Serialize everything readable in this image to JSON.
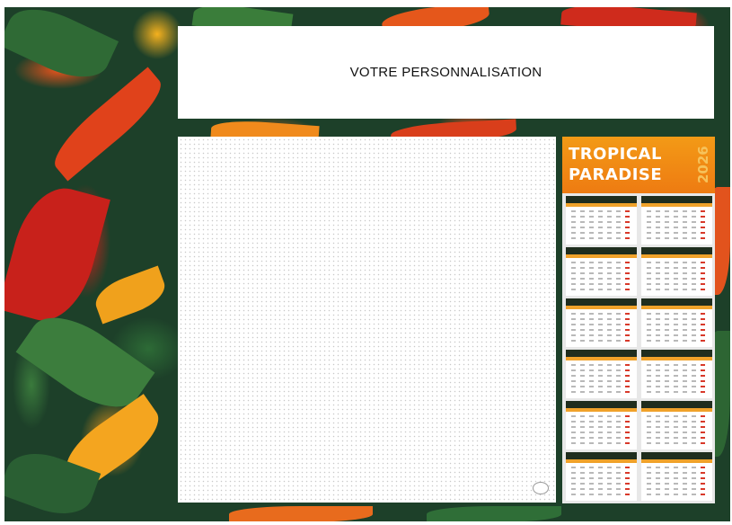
{
  "header": {
    "personalisation_text": "VOTRE PERSONNALISATION"
  },
  "calendar": {
    "title_line1": "TROPICAL",
    "title_line2": "PARADISE",
    "year": "2026",
    "colors": {
      "header": "#f39a16",
      "month_bar": "#1f2d1e",
      "accent": "#d8392a"
    }
  },
  "colors": {
    "background": "#1d4029",
    "foliage_red": "#d41f1a",
    "foliage_orange": "#ef6b1f"
  }
}
